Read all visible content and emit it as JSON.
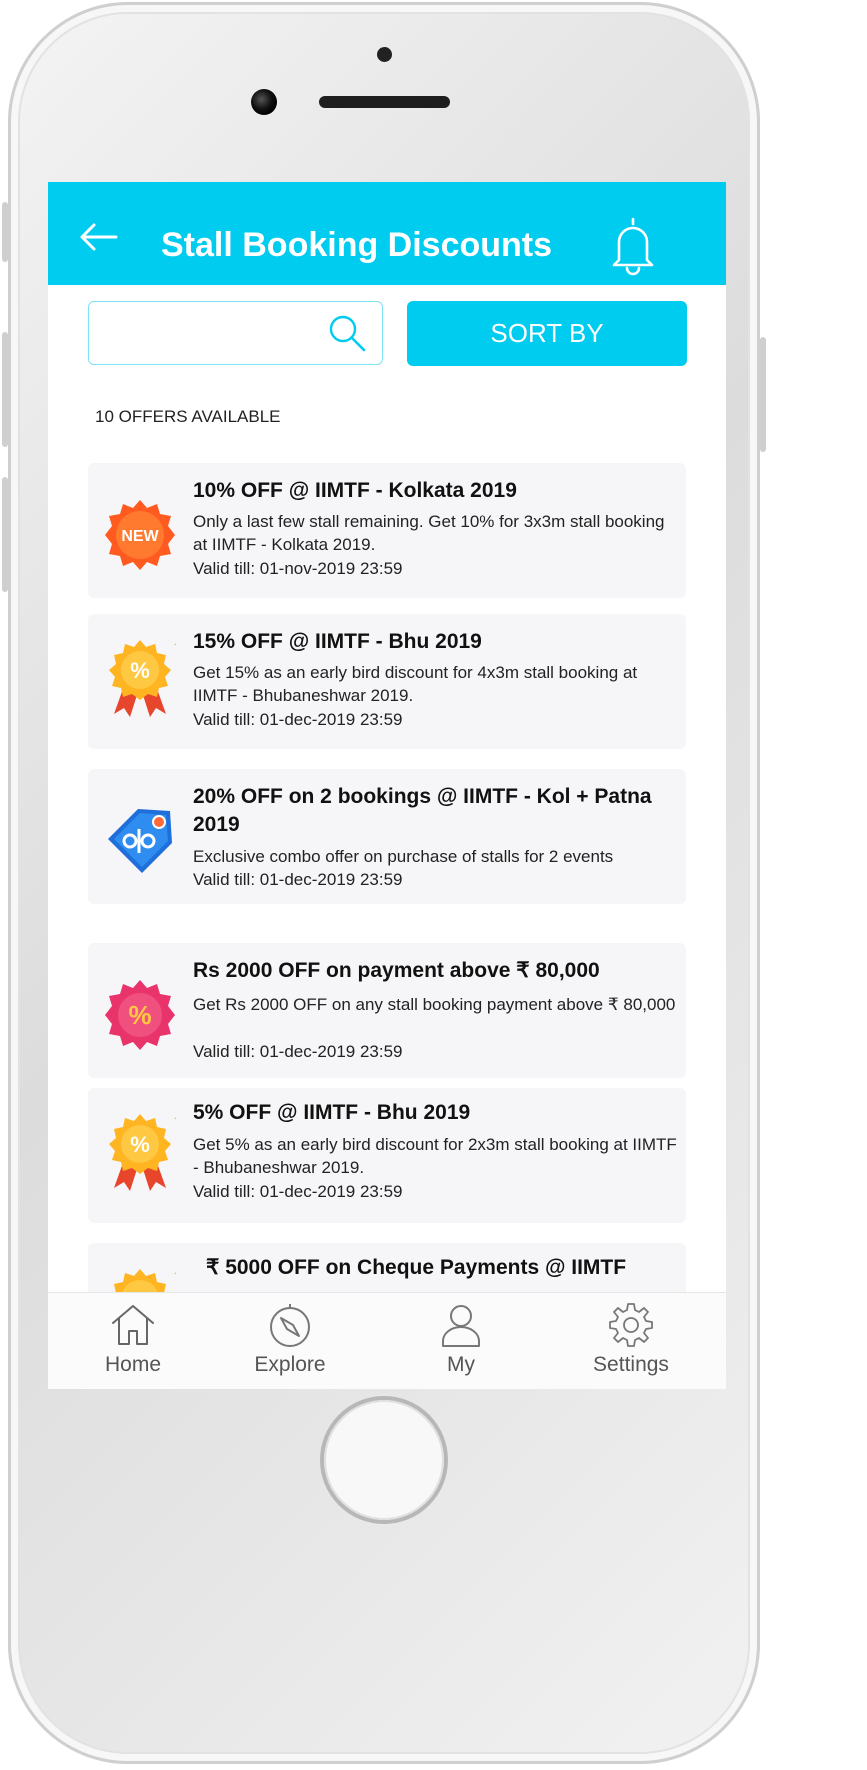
{
  "header": {
    "title": "Stall Booking Discounts",
    "sort_label": "SORT BY"
  },
  "search": {
    "value": "",
    "placeholder": ""
  },
  "offers_count": "10 OFFERS AVAILABLE",
  "offers": [
    {
      "title": "10% OFF  @ IIMTF - Kolkata 2019",
      "desc": "Only a last few stall remaining. Get 10% for 3x3m stall booking at IIMTF - Kolkata 2019.",
      "valid": "Valid till: 01-nov-2019 23:59",
      "icon": "new-badge-icon",
      "badge_text": "NEW"
    },
    {
      "title": "15% OFF  @ IIMTF - Bhu 2019",
      "desc": "Get 15% as an early bird discount for 4x3m stall booking at IIMTF - Bhubaneshwar 2019.",
      "valid": "Valid till: 01-dec-2019 23:59",
      "icon": "percent-ribbon-icon"
    },
    {
      "title": "20% OFF on 2 bookings @ IIMTF - Kol + Patna 2019",
      "desc": "Exclusive combo offer on purchase of stalls for  2 events",
      "valid": "Valid till: 01-dec-2019 23:59",
      "icon": "price-tag-icon"
    },
    {
      "title": "Rs 2000 OFF on payment above ₹ 80,000",
      "desc": "Get Rs 2000 OFF on any stall booking payment above ₹ 80,000",
      "valid": "Valid till: 01-dec-2019 23:59",
      "icon": "percent-badge-icon"
    },
    {
      "title": "5% OFF @ IIMTF - Bhu 2019",
      "desc": "Get 5% as an early bird discount for 2x3m stall booking at IIMTF - Bhubaneshwar 2019.",
      "valid": "Valid till: 01-dec-2019 23:59",
      "icon": "percent-ribbon-icon"
    },
    {
      "title": " ₹ 5000 OFF on Cheque Payments @ IIMTF",
      "desc": "",
      "valid": "",
      "icon": "percent-ribbon-icon"
    }
  ],
  "tabs": [
    {
      "label": "Home",
      "icon": "home-icon"
    },
    {
      "label": "Explore",
      "icon": "compass-icon"
    },
    {
      "label": "My",
      "icon": "user-icon"
    },
    {
      "label": "Settings",
      "icon": "gear-icon"
    }
  ],
  "colors": {
    "accent": "#00ccf0",
    "card_bg": "#f6f6f8"
  }
}
